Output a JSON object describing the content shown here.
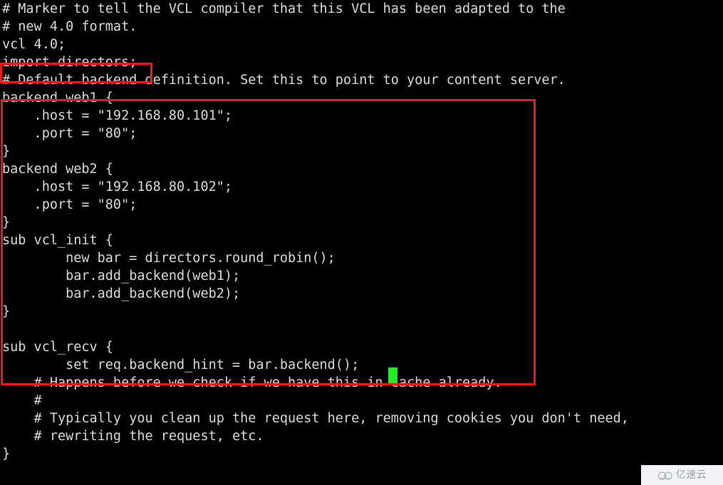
{
  "terminal": {
    "background_color": "#000000",
    "foreground_color": "#d8d8d8",
    "cursor_color": "#20f020",
    "annotation_color": "#e8181c",
    "lines": [
      "# Marker to tell the VCL compiler that this VCL has been adapted to the",
      "# new 4.0 format.",
      "vcl 4.0;",
      "import directors;",
      "# Default backend definition. Set this to point to your content server.",
      "backend web1 {",
      "    .host = \"192.168.80.101\";",
      "    .port = \"80\";",
      "}",
      "backend web2 {",
      "    .host = \"192.168.80.102\";",
      "    .port = \"80\";",
      "}",
      "sub vcl_init {",
      "        new bar = directors.round_robin();",
      "        bar.add_backend(web1);",
      "        bar.add_backend(web2);",
      "}",
      "",
      "sub vcl_recv {",
      "        set req.backend_hint = bar.backend();",
      "    # Happens before we check if we have this in cache already.",
      "    #",
      "    # Typically you clean up the request here, removing cookies you don't need,",
      "    # rewriting the request, etc.",
      "}"
    ]
  },
  "annotations": {
    "import_box": {
      "label": "import-directors-highlight",
      "target_text": "import directors;"
    },
    "config_box": {
      "label": "backend-and-director-config-highlight",
      "target_text": "backend web1 { ... set req.backend_hint = bar.backend();"
    }
  },
  "cursor": {
    "label": "block-cursor",
    "after_text": "set req.backend_hint = bar.backend();"
  },
  "watermark": {
    "text": "亿速云",
    "icon": "cloud-icon"
  }
}
